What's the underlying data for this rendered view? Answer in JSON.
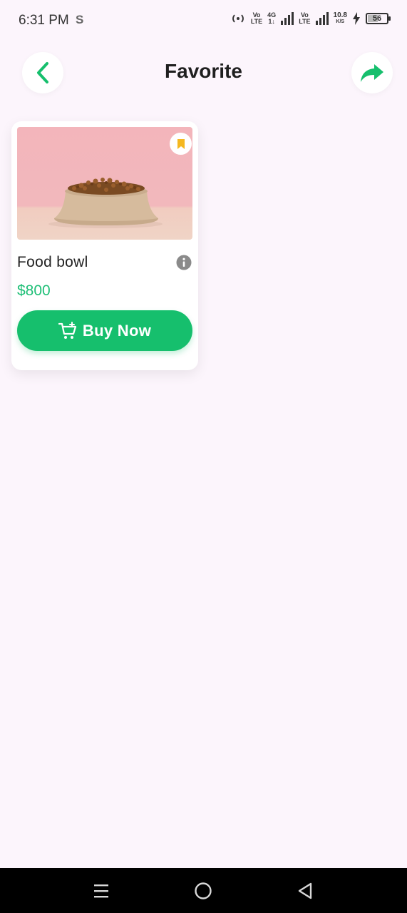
{
  "status_bar": {
    "time": "6:31 PM",
    "app_indicator": "S",
    "vo_lte_1_top": "Vo",
    "vo_lte_1_bottom": "LTE",
    "net_4g_top": "4G",
    "net_4g_bottom": "1↓",
    "vo_lte_2_top": "Vo",
    "vo_lte_2_bottom": "LTE",
    "speed_value": "10.8",
    "speed_unit": "K/S",
    "battery_level": "56"
  },
  "header": {
    "title": "Favorite",
    "back_icon": "chevron-left-icon",
    "share_icon": "share-arrow-icon"
  },
  "favorites": [
    {
      "name": "Food bowl",
      "price": "$800",
      "button_label": "Buy Now",
      "bookmarked": true
    }
  ],
  "colors": {
    "accent": "#16bf6d",
    "price": "#1fbf77",
    "bookmark": "#f5b820",
    "background": "#fcf5fc"
  }
}
